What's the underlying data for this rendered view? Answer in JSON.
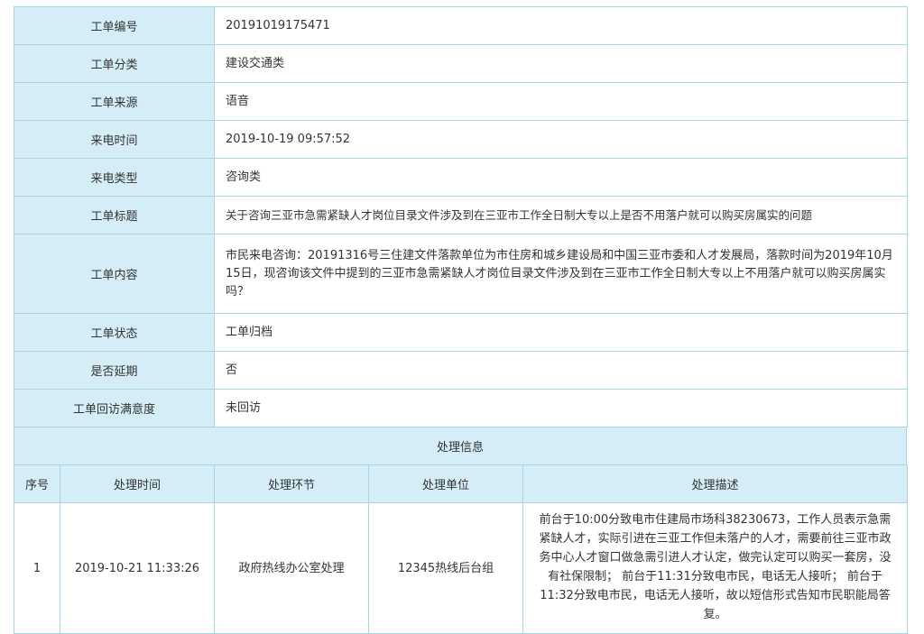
{
  "info_rows": [
    {
      "label": "工单编号",
      "value": "20191019175471"
    },
    {
      "label": "工单分类",
      "value": "建设交通类"
    },
    {
      "label": "工单来源",
      "value": "语音"
    },
    {
      "label": "来电时间",
      "value": "2019-10-19 09:57:52"
    },
    {
      "label": "来电类型",
      "value": "咨询类"
    },
    {
      "label": "工单标题",
      "value": "关于咨询三亚市急需紧缺人才岗位目录文件涉及到在三亚市工作全日制大专以上是否不用落户就可以购买房属实的问题"
    },
    {
      "label": "工单内容",
      "value": "市民来电咨询：20191316号三住建文件落款单位为市住房和城乡建设局和中国三亚市委和人才发展局，落款时间为2019年10月15日，现咨询该文件中提到的三亚市急需紧缺人才岗位目录文件涉及到在三亚市工作全日制大专以上不用落户就可以购买房属实吗？"
    },
    {
      "label": "工单状态",
      "value": "工单归档"
    },
    {
      "label": "是否延期",
      "value": "否"
    },
    {
      "label": "工单回访满意度",
      "value": "未回访"
    }
  ],
  "process": {
    "section_title": "处理信息",
    "headers": [
      "序号",
      "处理时间",
      "处理环节",
      "处理单位",
      "处理描述"
    ],
    "rows": [
      {
        "index": "1",
        "time": "2019-10-21 11:33:26",
        "step": "政府热线办公室处理",
        "unit": "12345热线后台组",
        "desc": "前台于10:00分致电市住建局市场科38230673，工作人员表示急需紧缺人才，实际引进在三亚工作但未落户的人才，需要前往三亚市政务中心人才窗口做急需引进人才认定，做完认定可以购买一套房，没有社保限制； 前台于11:31分致电市民，电话无人接听； 前台于11:32分致电市民，电话无人接听，故以短信形式告知市民职能局答复。"
      }
    ]
  }
}
